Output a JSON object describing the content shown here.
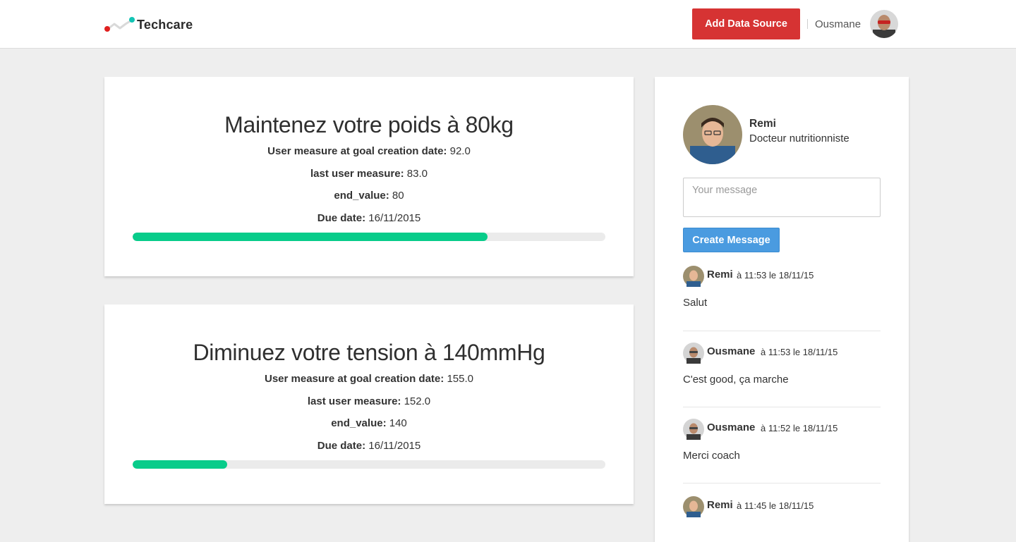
{
  "header": {
    "brand": "Techcare",
    "add_source_label": "Add Data Source",
    "user_name": "Ousmane"
  },
  "goals": [
    {
      "title": "Maintenez votre poids à 80kg",
      "creation_label": "User measure at goal creation date:",
      "creation_value": "92.0",
      "last_label": "last user measure:",
      "last_value": "83.0",
      "end_label": "end_value:",
      "end_value": "80",
      "due_label": "Due date:",
      "due_value": "16/11/2015",
      "progress": 0.75
    },
    {
      "title": "Diminuez votre tension à 140mmHg",
      "creation_label": "User measure at goal creation date:",
      "creation_value": "155.0",
      "last_label": "last user measure:",
      "last_value": "152.0",
      "end_label": "end_value:",
      "end_value": "140",
      "due_label": "Due date:",
      "due_value": "16/11/2015",
      "progress": 0.2
    }
  ],
  "coach": {
    "name": "Remi",
    "role": "Docteur nutritionniste",
    "message_placeholder": "Your message",
    "message_value": "",
    "create_label": "Create Message"
  },
  "messages": [
    {
      "author": "Remi",
      "time": "à 11:53 le 18/11/15",
      "text": "Salut"
    },
    {
      "author": "Ousmane",
      "time": "à 11:53 le 18/11/15",
      "text": "C'est good, ça marche"
    },
    {
      "author": "Ousmane",
      "time": "à 11:52 le 18/11/15",
      "text": "Merci coach"
    },
    {
      "author": "Remi",
      "time": "à 11:45 le 18/11/15",
      "text": ""
    }
  ],
  "colors": {
    "accent_red": "#d63333",
    "accent_blue": "#4a9be0",
    "progress_green": "#08cc8a",
    "logo_red": "#e0201f",
    "logo_teal": "#12c4b4"
  }
}
